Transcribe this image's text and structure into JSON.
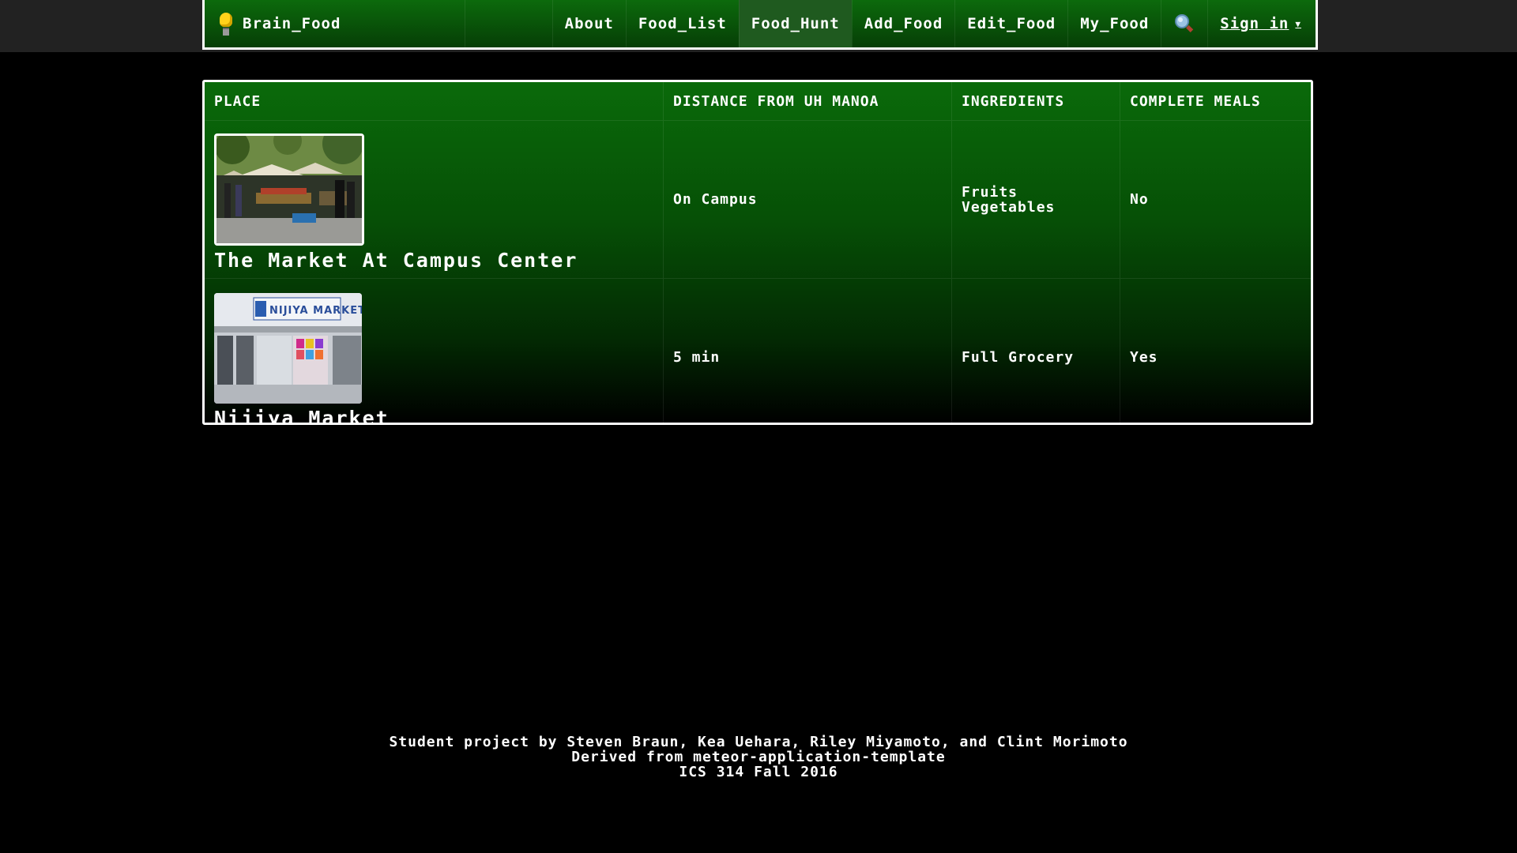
{
  "nav": {
    "brand": "Brain_Food",
    "items": [
      {
        "label": "About"
      },
      {
        "label": "Food_List"
      },
      {
        "label": "Food_Hunt"
      },
      {
        "label": "Add_Food"
      },
      {
        "label": "Edit_Food"
      },
      {
        "label": "My_Food"
      }
    ],
    "active_item": "Food_Hunt",
    "signin": "Sign in"
  },
  "table": {
    "headers": [
      "PLACE",
      "DISTANCE FROM UH MANOA",
      "INGREDIENTS",
      "COMPLETE MEALS"
    ],
    "rows": [
      {
        "place": "The Market At Campus Center",
        "distance": "On Campus",
        "ingredients": [
          "Fruits",
          "Vegetables"
        ],
        "complete_meals": "No"
      },
      {
        "place": "Nijiya Market",
        "distance": "5 min",
        "ingredients": [
          "Full Grocery"
        ],
        "complete_meals": "Yes"
      }
    ],
    "photo_sign_text": "NIJIYA MARKET"
  },
  "footer": {
    "line1": "Student project by Steven Braun, Kea Uehara, Riley Miyamoto, and Clint Morimoto",
    "line2": "Derived from meteor-application-template",
    "line3": "ICS 314 Fall 2016"
  },
  "colors": {
    "nav_green": "#0c6a0c",
    "active_tab": "#1f5a1f",
    "table_green_top": "#0a6a0a",
    "background": "#000000",
    "topbar": "#222222"
  }
}
